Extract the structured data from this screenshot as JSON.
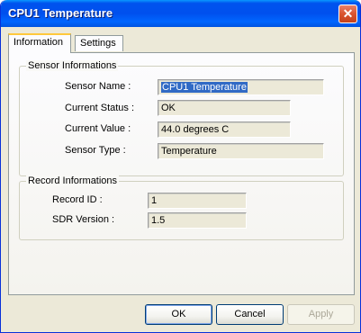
{
  "window": {
    "title": "CPU1 Temperature",
    "close_glyph": "✕"
  },
  "tabs": [
    {
      "label": "Information",
      "active": true
    },
    {
      "label": "Settings",
      "active": false
    }
  ],
  "sensor": {
    "title": "Sensor Informations",
    "name_label": "Sensor Name :",
    "name_value": "CPU1 Temperature",
    "status_label": "Current Status :",
    "status_value": "OK",
    "value_label": "Current Value :",
    "value_value": "44.0 degrees C",
    "type_label": "Sensor Type   :",
    "type_value": "Temperature"
  },
  "record": {
    "title": "Record Informations",
    "id_label": "Record ID    :",
    "id_value": "1",
    "sdr_label": "SDR Version :",
    "sdr_value": "1.5"
  },
  "buttons": {
    "ok": "OK",
    "cancel": "Cancel",
    "apply": "Apply"
  },
  "colors": {
    "titlebar": "#0053ee",
    "selection": "#316ac5",
    "dialog_bg": "#ece9d8"
  }
}
